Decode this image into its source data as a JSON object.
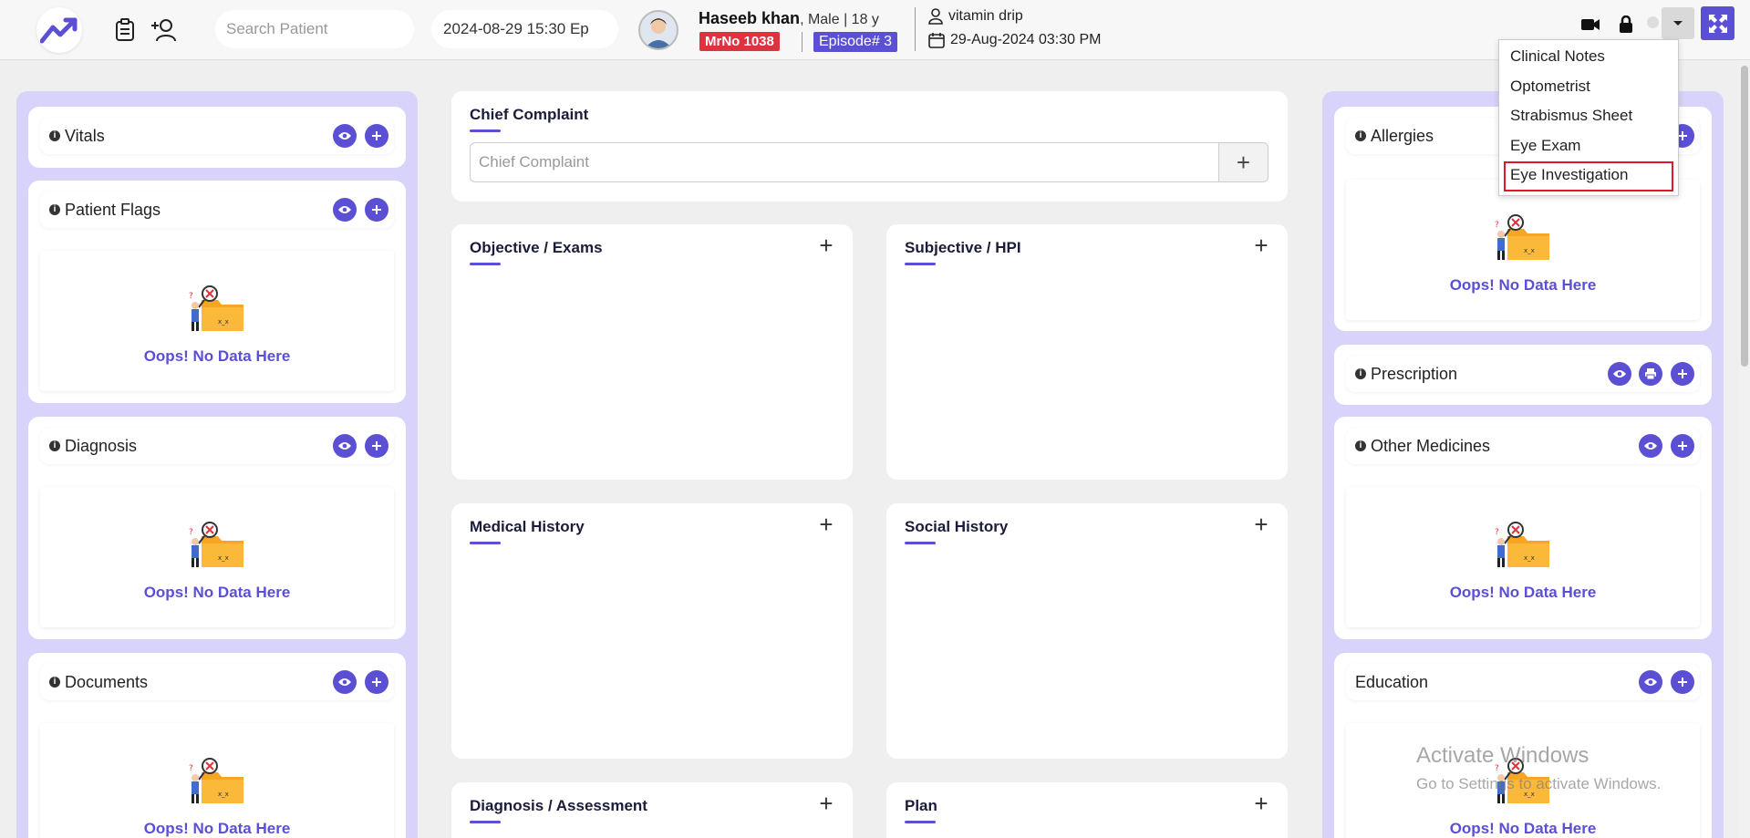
{
  "header": {
    "search_placeholder": "Search Patient",
    "datetime_value": "2024-08-29 15:30 Ep",
    "patient": {
      "name": "Haseeb khan",
      "meta": ", Male | 18 y",
      "mrno": "MrNo 1038",
      "episode": "Episode# 3"
    },
    "visit": {
      "reason": "vitamin drip",
      "datetime": "29-Aug-2024 03:30 PM"
    }
  },
  "colors": {
    "accent": "#5b4fd4",
    "danger": "#e0323e",
    "panel": "#d7d3fb"
  },
  "dropdown": {
    "items": [
      "Clinical Notes",
      "Optometrist",
      "Strabismus Sheet",
      "Eye Exam",
      "Eye Investigation"
    ]
  },
  "left_panel": {
    "vitals": "Vitals",
    "patient_flags": "Patient Flags",
    "diagnosis": "Diagnosis",
    "documents": "Documents"
  },
  "right_panel": {
    "allergies": "Allergies",
    "prescription": "Prescription",
    "other_medicines": "Other Medicines",
    "education": "Education"
  },
  "empty_text": "Oops! No Data Here",
  "center": {
    "chief_complaint_title": "Chief Complaint",
    "chief_complaint_placeholder": "Chief Complaint",
    "objective": "Objective / Exams",
    "subjective": "Subjective / HPI",
    "medical_history": "Medical History",
    "social_history": "Social History",
    "diagnosis_assessment": "Diagnosis / Assessment",
    "plan": "Plan"
  },
  "watermark": {
    "line1": "Activate Windows",
    "line2": "Go to Settings to activate Windows."
  }
}
